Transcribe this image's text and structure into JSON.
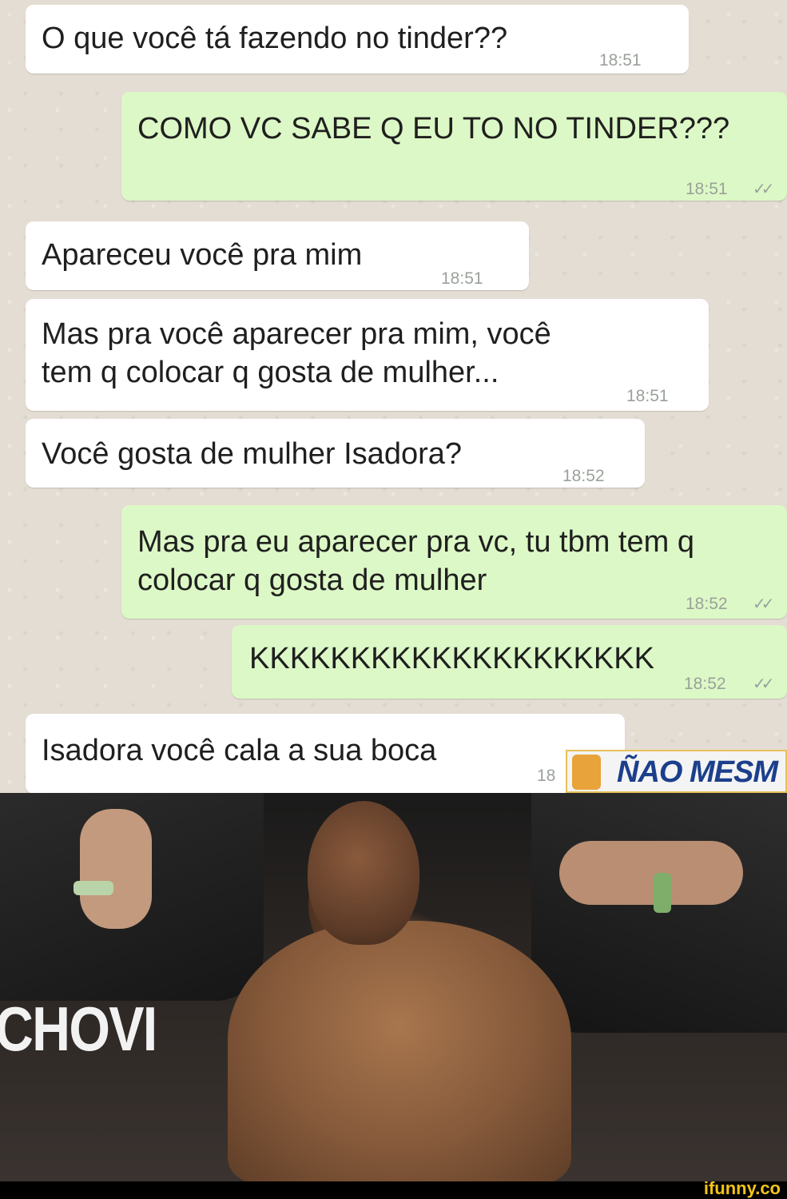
{
  "messages": [
    {
      "direction": "in",
      "lines": [
        "O que você tá fazendo no tinder??"
      ],
      "time": "18:51"
    },
    {
      "direction": "out",
      "lines": [
        "COMO VC SABE Q EU TO NO TINDER???"
      ],
      "time": "18:51",
      "ticks": "✓✓"
    },
    {
      "direction": "in",
      "lines": [
        "Apareceu você pra mim"
      ],
      "time": "18:51"
    },
    {
      "direction": "in",
      "lines": [
        "Mas pra você aparecer pra mim, você",
        "tem q colocar q gosta de mulher..."
      ],
      "time": "18:51"
    },
    {
      "direction": "in",
      "lines": [
        "Você gosta de mulher Isadora?"
      ],
      "time": "18:52"
    },
    {
      "direction": "out",
      "lines": [
        "Mas pra eu aparecer pra vc, tu tbm tem q",
        "colocar q gosta de mulher"
      ],
      "time": "18:52",
      "ticks": "✓✓"
    },
    {
      "direction": "out",
      "lines": [
        "KKKKKKKKKKKKKKKKKKKK"
      ],
      "time": "18:52",
      "ticks": "✓✓"
    },
    {
      "direction": "in",
      "lines": [
        "Isadora você cala a sua boca"
      ],
      "time": "18"
    }
  ],
  "sticker": {
    "label": "ÑAO MESM"
  },
  "meme": {
    "banner_text": "CHOVI"
  },
  "footer": {
    "watermark": "ifunny.co"
  },
  "colors": {
    "incoming": "#ffffff",
    "outgoing": "#dcf8c6",
    "background": "#e4ddd3"
  }
}
